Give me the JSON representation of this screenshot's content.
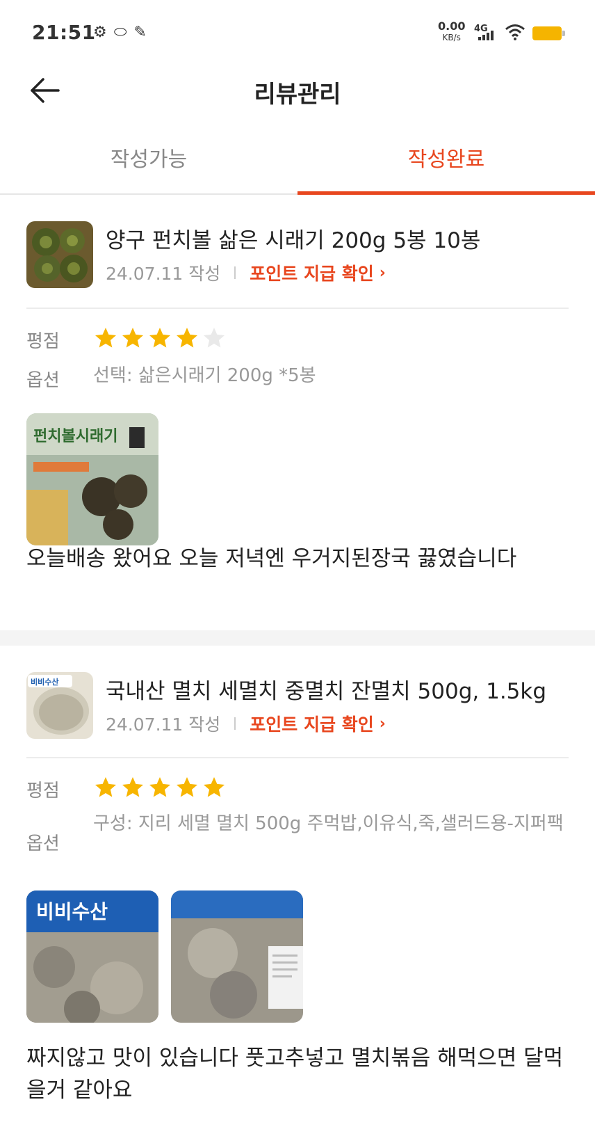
{
  "status_bar": {
    "time": "21:51",
    "speed_value": "0.00",
    "speed_unit": "KB/s",
    "network": "4G",
    "battery_color": "#f5b400"
  },
  "header": {
    "title": "리뷰관리",
    "back_icon": "back-arrow-icon"
  },
  "tabs": [
    {
      "label": "작성가능",
      "active": false
    },
    {
      "label": "작성완료",
      "active": true
    }
  ],
  "accent_color": "#e8461e",
  "reviews": [
    {
      "product_name": "양구 펀치볼 삶은 시래기 200g 5봉 10봉",
      "date": "24.07.11 작성",
      "point_link": "포인트 지급 확인",
      "rating_label": "평점",
      "rating": 4,
      "rating_max": 5,
      "option_label": "옵션",
      "option_value": "선택: 삶은시래기 200g *5봉",
      "photos": [
        {
          "caption": "펀치볼시래기"
        }
      ],
      "text": "오늘배송 왔어요 오늘 저녁엔 우거지된장국 끓였습니다"
    },
    {
      "product_name": "국내산 멸치 세멸치 중멸치 잔멸치 500g, 1.5kg",
      "date": "24.07.11 작성",
      "point_link": "포인트 지급 확인",
      "rating_label": "평점",
      "rating": 5,
      "rating_max": 5,
      "option_label": "옵션",
      "option_value": "구성: 지리 세멸 멸치 500g 주먹밥,이유식,죽,샐러드용-지퍼팩",
      "thumb_caption": "비비수산",
      "photos": [
        {
          "caption": "비비수산"
        },
        {
          "caption": ""
        }
      ],
      "text": "짜지않고 맛이 있습니다 풋고추넣고 멸치볶음 해먹으면 달먹을거 같아요"
    }
  ]
}
